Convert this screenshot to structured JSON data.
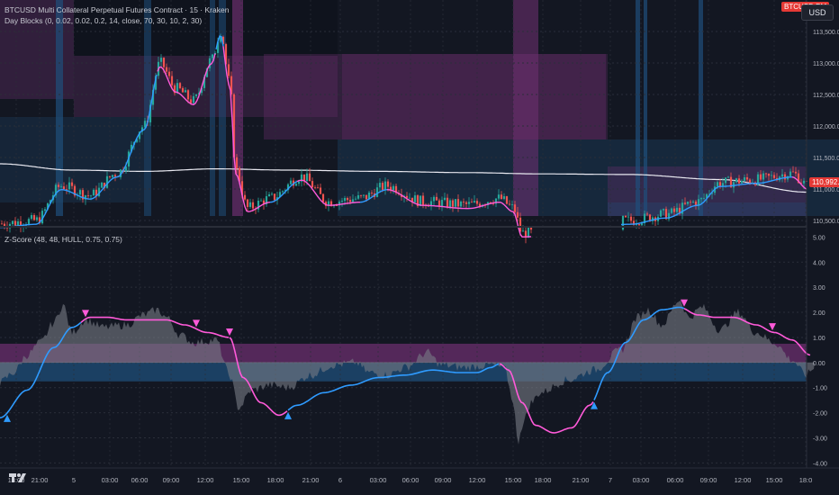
{
  "header": {
    "symbol_line": "BTCUSD Multi Collateral Perpetual Futures Contract · 15 · Kraken",
    "indicator_line": "Day Blocks (0, 0.02, 0.02, 0.2, 14, close, 70, 30, 10, 2, 30)",
    "symbol_badge": "BTCUSD.PM",
    "currency_button": "USD",
    "price_badge": "110,992.00"
  },
  "colors": {
    "background": "#131722",
    "grid": "#2a2e39",
    "bull": "#26a69a",
    "bear": "#ef5350",
    "ma_blue": "#2f9bff",
    "ma_pink": "#ff5ad9",
    "long_ma": "#e8e8f0",
    "zone_blue": "#1f4f7a",
    "zone_purple": "#6b2f6e",
    "area": "#787b86"
  },
  "chart_data": [
    {
      "type": "candlestick",
      "title": "BTCUSD Multi Collateral Perpetual Futures Contract · 15 · Kraken",
      "yticks": [
        "113,500.00",
        "113,000.00",
        "112,500.00",
        "112,000.00",
        "111,500.00",
        "111,000.00",
        "110,500.00"
      ],
      "ylim": [
        110400,
        114000
      ],
      "current_price_label": "110,992.00",
      "close_series_knots": [
        [
          0,
          110450
        ],
        [
          40,
          110500
        ],
        [
          68,
          111050
        ],
        [
          100,
          110900
        ],
        [
          130,
          111250
        ],
        [
          160,
          112000
        ],
        [
          178,
          113000
        ],
        [
          195,
          112600
        ],
        [
          215,
          112400
        ],
        [
          235,
          113050
        ],
        [
          245,
          113500
        ],
        [
          255,
          112700
        ],
        [
          262,
          111300
        ],
        [
          275,
          110700
        ],
        [
          300,
          110850
        ],
        [
          335,
          111200
        ],
        [
          365,
          110800
        ],
        [
          400,
          110850
        ],
        [
          430,
          111050
        ],
        [
          470,
          110800
        ],
        [
          520,
          110750
        ],
        [
          555,
          110850
        ],
        [
          570,
          110700
        ],
        [
          580,
          110300
        ],
        [
          700,
          110500
        ],
        [
          740,
          110600
        ],
        [
          775,
          110800
        ],
        [
          800,
          111100
        ],
        [
          840,
          111150
        ],
        [
          880,
          111250
        ],
        [
          898,
          111050
        ]
      ],
      "series": [
        {
          "name": "",
          "description": "blue/pink moving average",
          "colors": [
            "#2f9bff",
            "#ff5ad9"
          ]
        },
        {
          "name": "",
          "description": "long moving average",
          "color": "#e8e8f0"
        }
      ]
    },
    {
      "type": "area+line",
      "title": "Z-Score (48, 48, HULL, 0.75, 0.75)",
      "yticks": [
        "5.00",
        "4.00",
        "3.00",
        "2.00",
        "1.00",
        "0.00",
        "-1.00",
        "-2.00",
        "-3.00",
        "-4.00"
      ],
      "ylim": [
        -4.2,
        5.3
      ],
      "upper_band": [
        0.0,
        0.75
      ],
      "lower_band": [
        -0.75,
        0.0
      ],
      "zscore_knots": [
        [
          0,
          -0.8
        ],
        [
          15,
          -0.4
        ],
        [
          30,
          0.3
        ],
        [
          45,
          0.8
        ],
        [
          60,
          1.6
        ],
        [
          70,
          2.3
        ],
        [
          80,
          1.2
        ],
        [
          95,
          1.7
        ],
        [
          115,
          1.4
        ],
        [
          140,
          1.5
        ],
        [
          160,
          1.9
        ],
        [
          175,
          2.1
        ],
        [
          185,
          1.8
        ],
        [
          200,
          1.1
        ],
        [
          215,
          0.8
        ],
        [
          240,
          0.9
        ],
        [
          255,
          -0.5
        ],
        [
          265,
          -1.8
        ],
        [
          280,
          -1.1
        ],
        [
          300,
          -0.9
        ],
        [
          320,
          -1.0
        ],
        [
          345,
          -0.5
        ],
        [
          370,
          -0.1
        ],
        [
          395,
          0.0
        ],
        [
          410,
          -0.4
        ],
        [
          430,
          -0.5
        ],
        [
          450,
          -0.2
        ],
        [
          475,
          0.4
        ],
        [
          490,
          -0.1
        ],
        [
          515,
          -0.2
        ],
        [
          545,
          -0.1
        ],
        [
          560,
          -0.2
        ],
        [
          570,
          -1.5
        ],
        [
          575,
          -3.2
        ],
        [
          580,
          -2.5
        ],
        [
          590,
          -1.6
        ],
        [
          600,
          -1.2
        ],
        [
          630,
          -0.7
        ],
        [
          660,
          -0.3
        ],
        [
          690,
          0.5
        ],
        [
          708,
          1.8
        ],
        [
          720,
          2.1
        ],
        [
          735,
          1.5
        ],
        [
          755,
          2.5
        ],
        [
          765,
          1.8
        ],
        [
          780,
          2.2
        ],
        [
          800,
          1.3
        ],
        [
          820,
          2.0
        ],
        [
          840,
          1.2
        ],
        [
          860,
          0.8
        ],
        [
          880,
          0.1
        ],
        [
          895,
          -0.5
        ],
        [
          905,
          -0.2
        ]
      ],
      "smooth_knots": [
        [
          0,
          -2.2
        ],
        [
          30,
          -1.1
        ],
        [
          60,
          0.6
        ],
        [
          80,
          1.4
        ],
        [
          100,
          1.8
        ],
        [
          120,
          1.8
        ],
        [
          140,
          1.7
        ],
        [
          165,
          1.7
        ],
        [
          185,
          1.7
        ],
        [
          205,
          1.5
        ],
        [
          230,
          1.2
        ],
        [
          255,
          1.0
        ],
        [
          270,
          -0.6
        ],
        [
          290,
          -1.6
        ],
        [
          310,
          -2.1
        ],
        [
          330,
          -1.7
        ],
        [
          360,
          -1.2
        ],
        [
          390,
          -0.9
        ],
        [
          420,
          -0.6
        ],
        [
          450,
          -0.5
        ],
        [
          480,
          -0.3
        ],
        [
          510,
          -0.4
        ],
        [
          530,
          -0.4
        ],
        [
          545,
          -0.2
        ],
        [
          555,
          -0.05
        ],
        [
          565,
          -0.3
        ],
        [
          580,
          -1.6
        ],
        [
          595,
          -2.5
        ],
        [
          615,
          -2.8
        ],
        [
          635,
          -2.6
        ],
        [
          655,
          -1.7
        ],
        [
          675,
          -0.4
        ],
        [
          695,
          0.8
        ],
        [
          715,
          1.7
        ],
        [
          735,
          2.1
        ],
        [
          755,
          2.2
        ],
        [
          775,
          1.9
        ],
        [
          795,
          1.8
        ],
        [
          815,
          1.8
        ],
        [
          840,
          1.5
        ],
        [
          860,
          1.2
        ],
        [
          880,
          0.9
        ],
        [
          900,
          0.3
        ]
      ],
      "up_markers_x": [
        8,
        320,
        660
      ],
      "down_markers_x": [
        95,
        218,
        255,
        760,
        858
      ]
    }
  ],
  "time_axis": {
    "labels": [
      "18:00",
      "21:00",
      "5",
      "03:00",
      "06:00",
      "09:00",
      "12:00",
      "15:00",
      "18:00",
      "21:00",
      "6",
      "03:00",
      "06:00",
      "09:00",
      "12:00",
      "15:00",
      "18:00",
      "21:00",
      "7",
      "03:00",
      "06:00",
      "09:00",
      "12:00",
      "15:00",
      "18:0"
    ]
  }
}
